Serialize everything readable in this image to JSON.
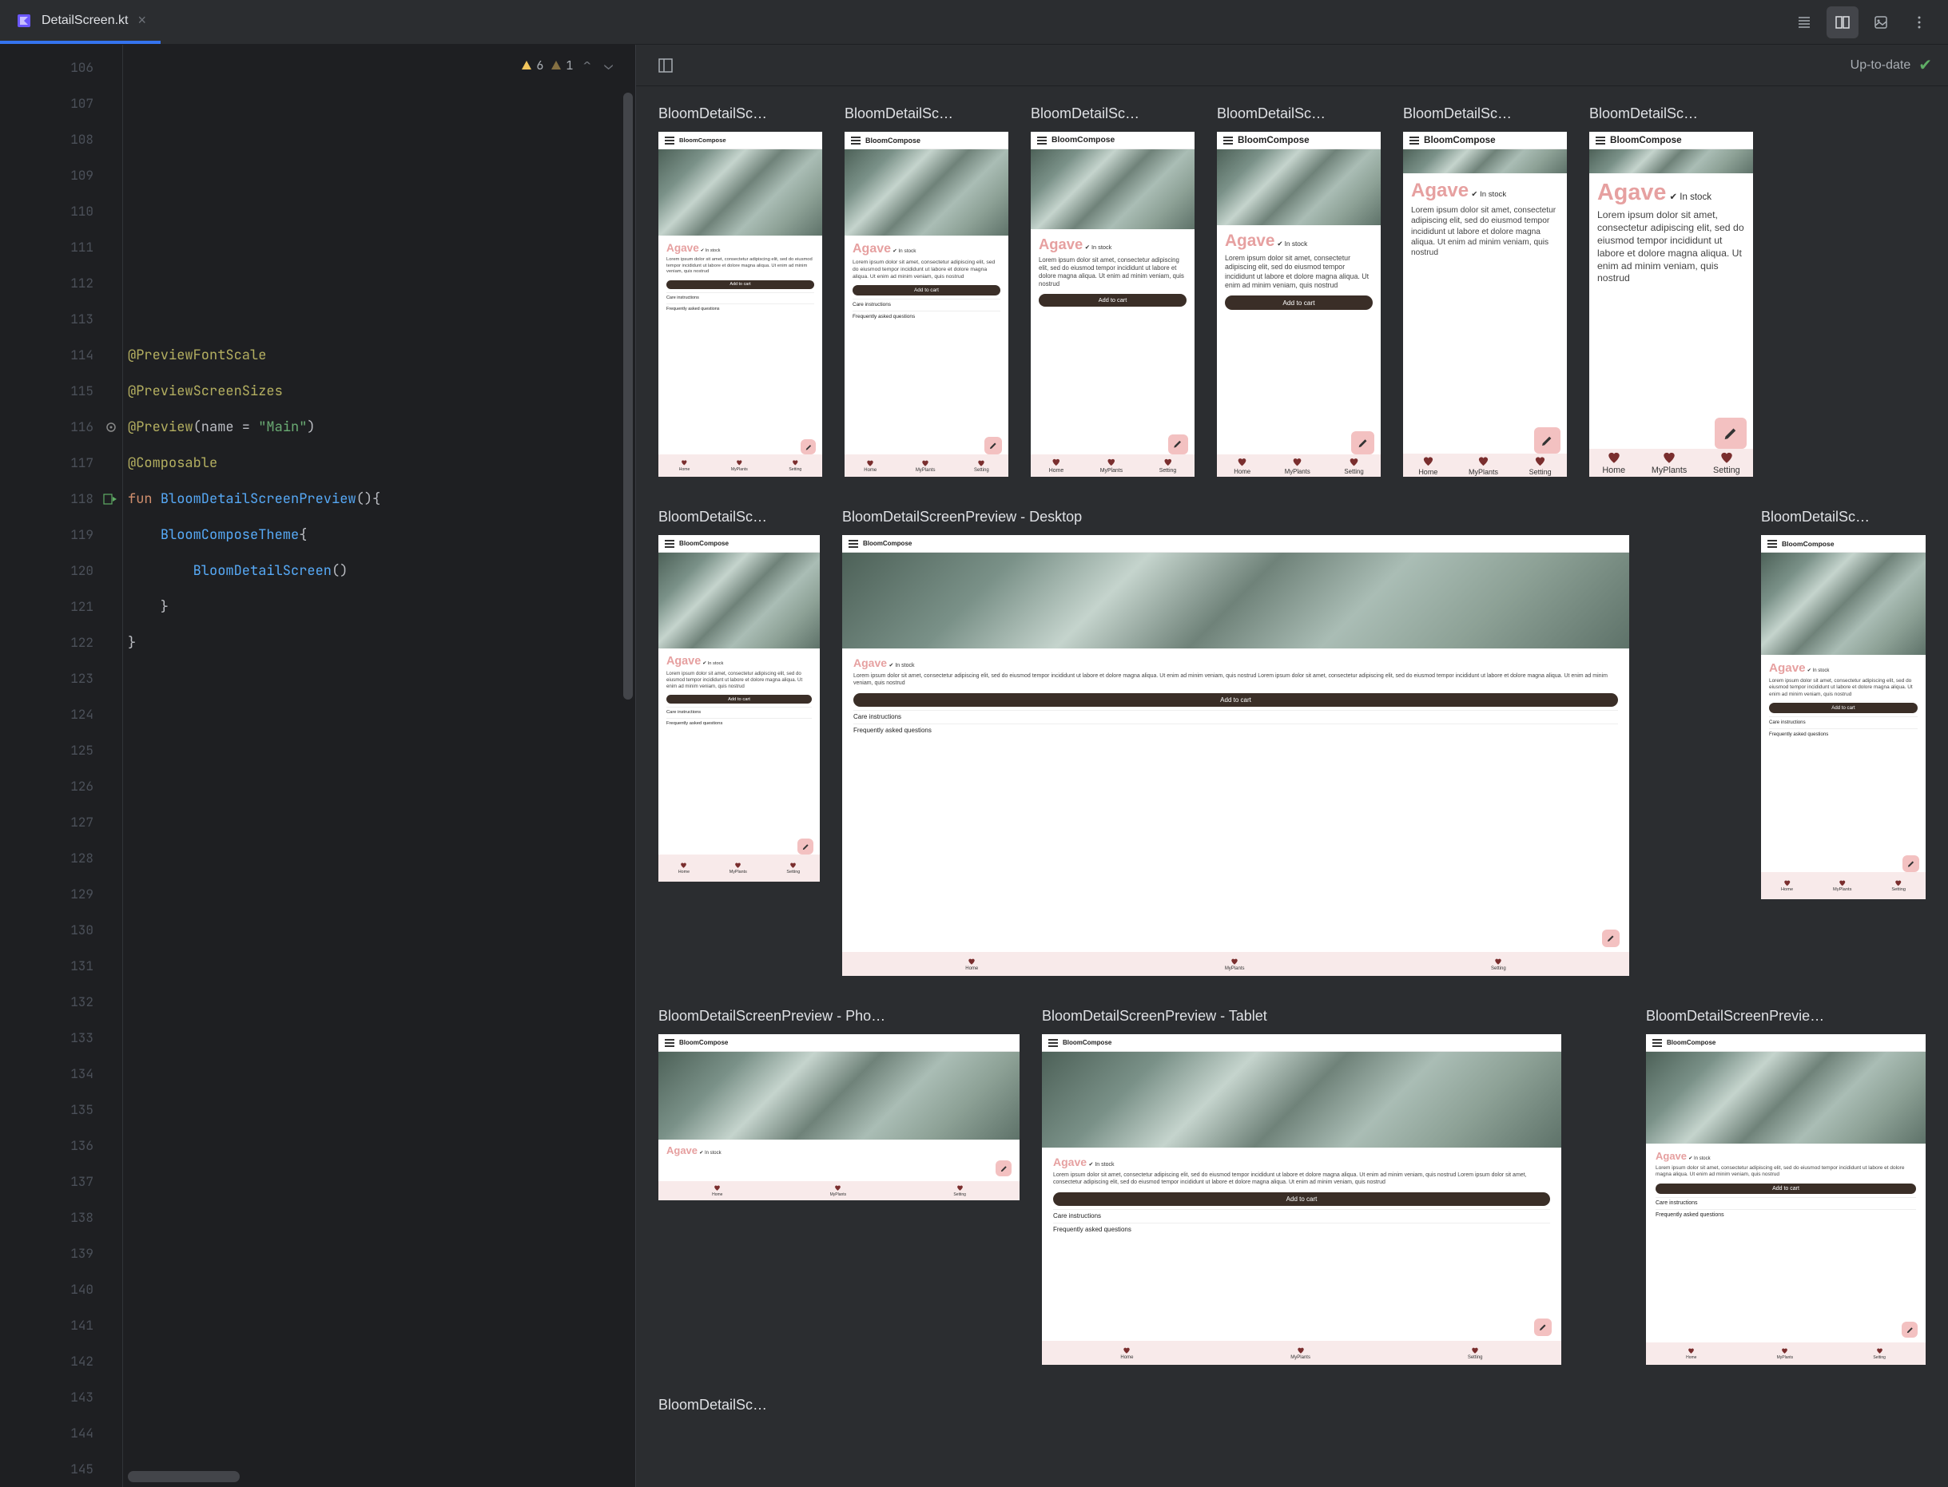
{
  "tab": {
    "filename": "DetailScreen.kt"
  },
  "inspections": {
    "warnings": "6",
    "weakWarnings": "1"
  },
  "editor": {
    "lines": [
      {
        "n": 106,
        "tokens": []
      },
      {
        "n": 107,
        "tokens": []
      },
      {
        "n": 108,
        "tokens": []
      },
      {
        "n": 109,
        "tokens": []
      },
      {
        "n": 110,
        "tokens": []
      },
      {
        "n": 111,
        "tokens": []
      },
      {
        "n": 112,
        "tokens": []
      },
      {
        "n": 113,
        "tokens": []
      },
      {
        "n": 114,
        "tokens": [
          {
            "t": "ann",
            "v": "@PreviewFontScale"
          }
        ]
      },
      {
        "n": 115,
        "tokens": [
          {
            "t": "ann",
            "v": "@PreviewScreenSizes"
          }
        ]
      },
      {
        "n": 116,
        "gutter": "gear",
        "tokens": [
          {
            "t": "ann",
            "v": "@Preview"
          },
          {
            "t": "punc",
            "v": "(name = "
          },
          {
            "t": "str",
            "v": "\"Main\""
          },
          {
            "t": "punc",
            "v": ")"
          }
        ]
      },
      {
        "n": 117,
        "tokens": [
          {
            "t": "ann",
            "v": "@Composable"
          }
        ]
      },
      {
        "n": 118,
        "gutter": "run",
        "tokens": [
          {
            "t": "kw",
            "v": "fun "
          },
          {
            "t": "fn",
            "v": "BloomDetailScreenPreview"
          },
          {
            "t": "punc",
            "v": "(){"
          }
        ]
      },
      {
        "n": 119,
        "tokens": [
          {
            "t": "punc",
            "v": "    "
          },
          {
            "t": "call",
            "v": "BloomComposeTheme"
          },
          {
            "t": "punc",
            "v": "{"
          }
        ]
      },
      {
        "n": 120,
        "tokens": [
          {
            "t": "punc",
            "v": "        "
          },
          {
            "t": "call",
            "v": "BloomDetailScreen"
          },
          {
            "t": "punc",
            "v": "()"
          }
        ]
      },
      {
        "n": 121,
        "tokens": [
          {
            "t": "punc",
            "v": "    }"
          }
        ]
      },
      {
        "n": 122,
        "tokens": [
          {
            "t": "punc",
            "v": "}"
          }
        ]
      },
      {
        "n": 123,
        "tokens": []
      },
      {
        "n": 124,
        "tokens": []
      },
      {
        "n": 125,
        "tokens": []
      },
      {
        "n": 126,
        "tokens": []
      },
      {
        "n": 127,
        "tokens": []
      },
      {
        "n": 128,
        "tokens": []
      },
      {
        "n": 129,
        "tokens": []
      },
      {
        "n": 130,
        "tokens": []
      },
      {
        "n": 131,
        "tokens": []
      },
      {
        "n": 132,
        "tokens": []
      },
      {
        "n": 133,
        "tokens": []
      },
      {
        "n": 134,
        "tokens": []
      },
      {
        "n": 135,
        "tokens": []
      },
      {
        "n": 136,
        "tokens": []
      },
      {
        "n": 137,
        "tokens": []
      },
      {
        "n": 138,
        "tokens": []
      },
      {
        "n": 139,
        "tokens": []
      },
      {
        "n": 140,
        "tokens": []
      },
      {
        "n": 141,
        "tokens": []
      },
      {
        "n": 142,
        "tokens": []
      },
      {
        "n": 143,
        "tokens": []
      },
      {
        "n": 144,
        "tokens": []
      },
      {
        "n": 145,
        "tokens": []
      }
    ]
  },
  "previewStatus": "Up-to-date",
  "previews": {
    "row1": [
      {
        "title": "BloomDetailSc…",
        "scale": "85%"
      },
      {
        "title": "BloomDetailSc…",
        "scale": "100%"
      },
      {
        "title": "BloomDetailSc…",
        "scale": "115%"
      },
      {
        "title": "BloomDetailSc…",
        "scale": "130%"
      },
      {
        "title": "BloomDetailSc…",
        "scale": "150%"
      },
      {
        "title": "BloomDetailSc…",
        "scale": "180%"
      }
    ],
    "row2": [
      {
        "title": "BloomDetailSc…"
      },
      {
        "title": "BloomDetailScreenPreview - Desktop"
      },
      {
        "title": "BloomDetailSc…"
      }
    ],
    "row3": [
      {
        "title": "BloomDetailScreenPreview - Pho…"
      },
      {
        "title": "BloomDetailScreenPreview - Tablet"
      },
      {
        "title": "BloomDetailScreenPrevie…"
      }
    ],
    "row4": [
      {
        "title": "BloomDetailSc…"
      }
    ]
  },
  "mockContent": {
    "appName": "BloomCompose",
    "plant": "Agave",
    "inStock": "In stock",
    "loremLong": "Lorem ipsum dolor sit amet, consectetur adipiscing elit, sed do eiusmod tempor incididunt ut labore et dolore magna aliqua. Ut enim ad minim veniam, quis nostrud",
    "addToCart": "Add to cart",
    "care": "Care instructions",
    "faq": "Frequently asked questions",
    "nav": {
      "home": "Home",
      "myplants": "MyPlants",
      "setting": "Setting"
    }
  }
}
